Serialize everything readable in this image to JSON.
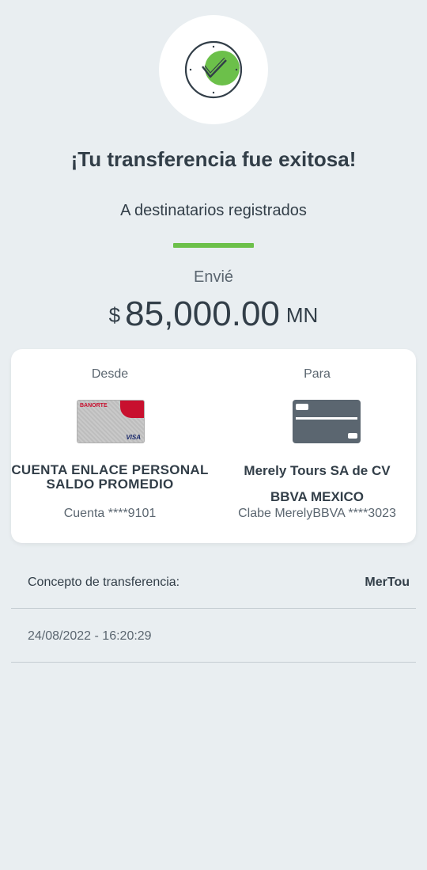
{
  "header": {
    "icon": "check-clock-icon",
    "title": "¡Tu transferencia fue exitosa!",
    "subtitle": "A destinatarios registrados",
    "accent_color": "#6cc04a"
  },
  "amount": {
    "label": "Envié",
    "currency_symbol": "$",
    "value": "85,000.00",
    "unit": "MN"
  },
  "from": {
    "label": "Desde",
    "card_brand": "BANORTE",
    "card_network": "VISA",
    "account_name": "CUENTA ENLACE PERSONAL SALDO PROMEDIO",
    "account_detail": "Cuenta ****9101"
  },
  "to": {
    "label": "Para",
    "icon": "credit-card-icon",
    "name": "Merely Tours SA de CV",
    "bank": "BBVA MEXICO",
    "detail": "Clabe MerelyBBVA ****3023"
  },
  "details": {
    "concept_label": "Concepto de transferencia:",
    "concept_value": "MerTou",
    "datetime": "24/08/2022 - 16:20:29"
  }
}
